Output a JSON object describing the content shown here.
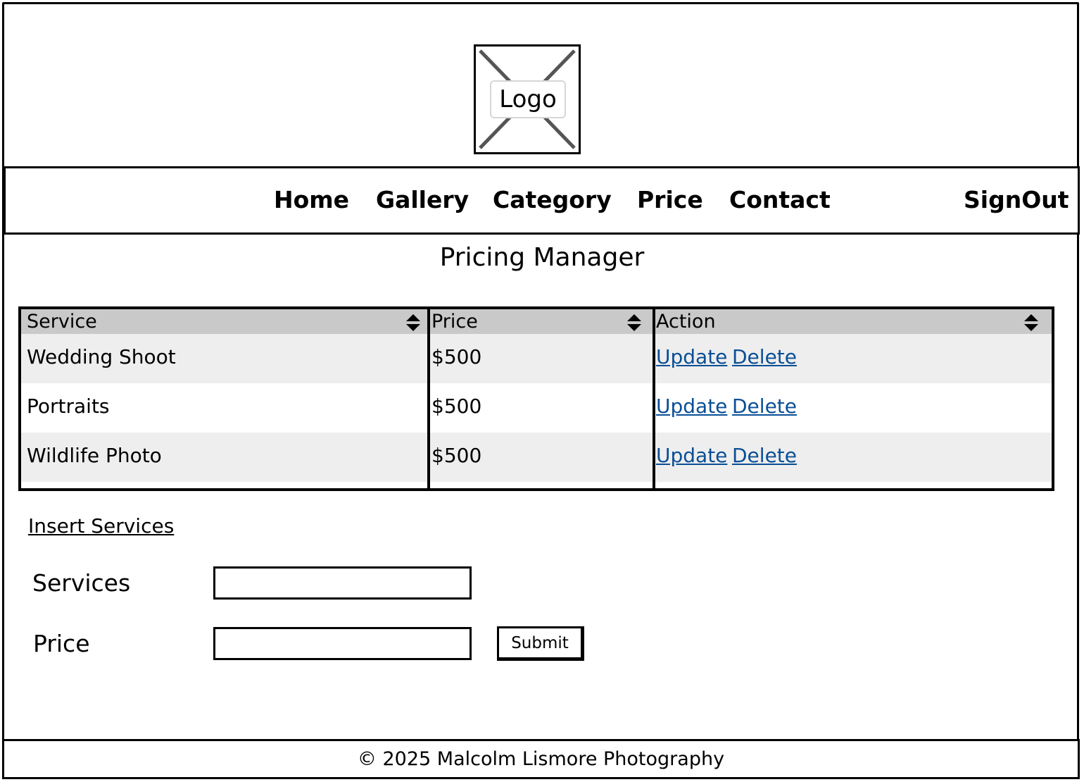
{
  "logo": {
    "label": "Logo"
  },
  "nav": {
    "items": [
      {
        "label": "Home"
      },
      {
        "label": "Gallery"
      },
      {
        "label": "Category"
      },
      {
        "label": "Price"
      },
      {
        "label": "Contact"
      }
    ],
    "signout_label": "SignOut"
  },
  "page": {
    "title": "Pricing Manager"
  },
  "table": {
    "columns": [
      "Service",
      "Price",
      "Action"
    ],
    "rows": [
      {
        "service": "Wedding Shoot",
        "price": "$500",
        "update": "Update",
        "delete": "Delete"
      },
      {
        "service": "Portraits",
        "price": "$500",
        "update": "Update",
        "delete": "Delete"
      },
      {
        "service": "Wildlife Photo",
        "price": "$500",
        "update": "Update",
        "delete": "Delete"
      }
    ]
  },
  "form": {
    "insert_link": "Insert Services",
    "services_label": "Services",
    "services_value": "",
    "price_label": "Price",
    "price_value": "",
    "submit_label": "Submit"
  },
  "footer": {
    "text": "© 2025 Malcolm Lismore Photography"
  },
  "icons": {
    "sort": "sort-icon",
    "logo": "image-placeholder-icon"
  },
  "colors": {
    "header_bg": "#c9c9c9",
    "row_alt_bg": "#eeeeee",
    "link": "#0a4f96"
  }
}
